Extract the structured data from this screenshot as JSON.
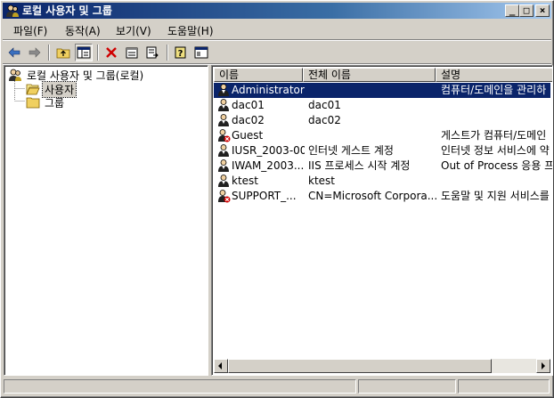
{
  "window": {
    "title": "로컬 사용자 및 그룹"
  },
  "title_buttons": {
    "minimize": "_",
    "maximize": "□",
    "close": "×"
  },
  "menu": [
    {
      "label": "파일(F)"
    },
    {
      "label": "동작(A)"
    },
    {
      "label": "보기(V)"
    },
    {
      "label": "도움말(H)"
    }
  ],
  "tree": {
    "root": "로컬 사용자 및 그룹(로컬)",
    "children": [
      "사용자",
      "그룹"
    ],
    "selected": "사용자"
  },
  "list": {
    "columns": [
      "이름",
      "전체 이름",
      "설명"
    ],
    "rows": [
      {
        "name": "Administrator",
        "full_name": "",
        "description": "컴퓨터/도메인을 관리하",
        "disabled": false,
        "selected": true
      },
      {
        "name": "dac01",
        "full_name": "dac01",
        "description": "",
        "disabled": false,
        "selected": false
      },
      {
        "name": "dac02",
        "full_name": "dac02",
        "description": "",
        "disabled": false,
        "selected": false
      },
      {
        "name": "Guest",
        "full_name": "",
        "description": "게스트가 컴퓨터/도메인",
        "disabled": true,
        "selected": false
      },
      {
        "name": "IUSR_2003-00",
        "full_name": "인터넷 게스트 계정",
        "description": "인터넷 정보 서비스에 약",
        "disabled": false,
        "selected": false
      },
      {
        "name": "IWAM_2003...",
        "full_name": "IIS 프로세스 시작 계정",
        "description": "Out of Process 응용 프",
        "disabled": false,
        "selected": false
      },
      {
        "name": "ktest",
        "full_name": "ktest",
        "description": "",
        "disabled": false,
        "selected": false
      },
      {
        "name": "SUPPORT_...",
        "full_name": "CN=Microsoft Corpora...",
        "description": "도움말 및 지원 서비스를",
        "disabled": true,
        "selected": false
      }
    ]
  },
  "colors": {
    "title_start": "#0a246a",
    "title_end": "#a6caf0",
    "selection": "#0a246a",
    "face": "#d4d0c8"
  }
}
